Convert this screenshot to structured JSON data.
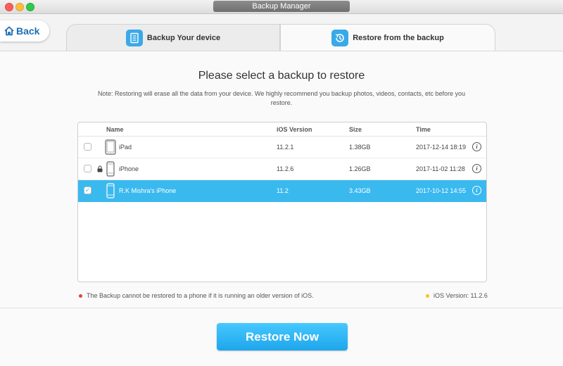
{
  "window": {
    "title": "Backup Manager"
  },
  "nav": {
    "back_label": "Back"
  },
  "tabs": [
    {
      "label": "Backup Your device",
      "icon": "document-icon"
    },
    {
      "label": "Restore from the backup",
      "icon": "restore-clock-icon"
    }
  ],
  "main": {
    "heading": "Please select a backup to restore",
    "note": "Note: Restoring will erase all the data from your device. We highly recommend you backup photos, videos, contacts, etc before you restore."
  },
  "table": {
    "columns": [
      "Name",
      "iOS Version",
      "Size",
      "Time"
    ],
    "rows": [
      {
        "name": "iPad",
        "ios": "11.2.1",
        "size": "1.38GB",
        "time": "2017-12-14 18:19",
        "checked": false,
        "locked": false,
        "device": "ipad"
      },
      {
        "name": "iPhone",
        "ios": "11.2.6",
        "size": "1.26GB",
        "time": "2017-11-02 11:28",
        "checked": false,
        "locked": true,
        "device": "iphone"
      },
      {
        "name": "R.K Mishra's iPhone",
        "ios": "11.2",
        "size": "3.43GB",
        "time": "2017-10-12 14:55",
        "checked": true,
        "locked": false,
        "device": "iphone"
      }
    ]
  },
  "footer": {
    "warning": "The Backup cannot be restored to a phone if it is running an older version of iOS.",
    "ios_version": "iOS Version: 11.2.6",
    "restore_label": "Restore Now"
  },
  "colors": {
    "accent": "#3ab9ef",
    "warning_dot": "#e0443e",
    "version_dot": "#f5c518"
  }
}
